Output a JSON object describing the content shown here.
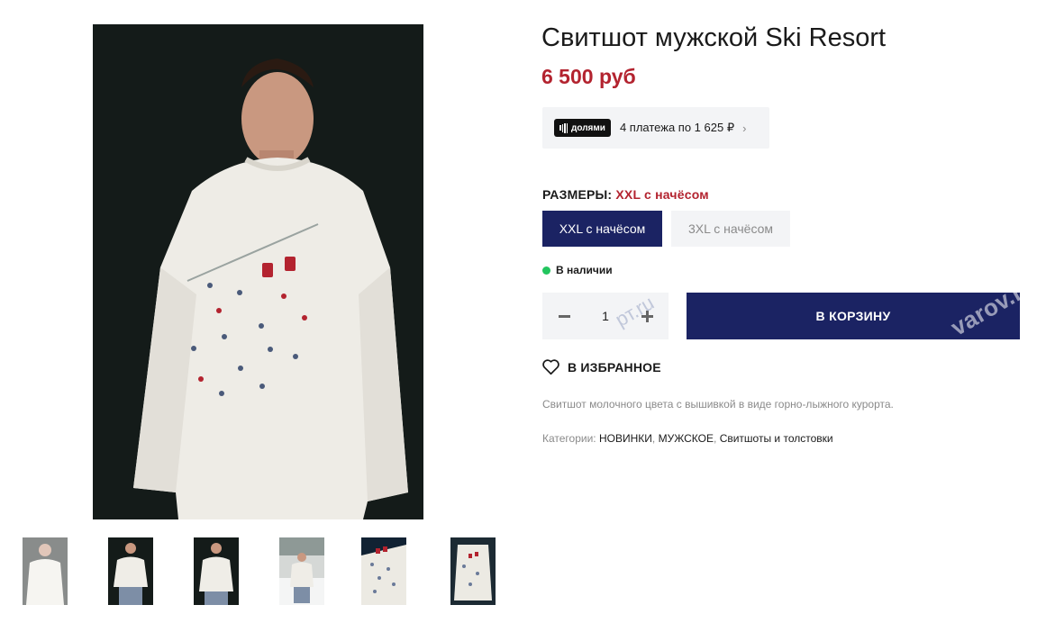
{
  "product": {
    "title": "Свитшот мужской Ski Resort",
    "price": "6 500 руб",
    "description": "Свитшот молочного цвета с вышивкой в виде горно-лыжного курорта."
  },
  "installment": {
    "badge": "долями",
    "text": "4 платежа по 1 625 ₽"
  },
  "sizes": {
    "label": "РАЗМЕРЫ:",
    "selected_value": "XXL с начёсом",
    "options": [
      "XXL с начёсом",
      "3XL с начёсом"
    ]
  },
  "stock": {
    "text": "В наличии"
  },
  "quantity": {
    "value": "1"
  },
  "cart": {
    "label": "В КОРЗИНУ"
  },
  "favorite": {
    "label": "В ИЗБРАННОЕ"
  },
  "categories": {
    "label": "Категории:",
    "items": [
      "НОВИНКИ",
      "МУЖСКОЕ",
      "Свитшоты и толстовки"
    ]
  },
  "watermark": {
    "text_a": "рт.ru",
    "text_b": "varov.r"
  },
  "colors": {
    "accent": "#1b2363",
    "price": "#b3232f",
    "in_stock": "#22c55e"
  }
}
